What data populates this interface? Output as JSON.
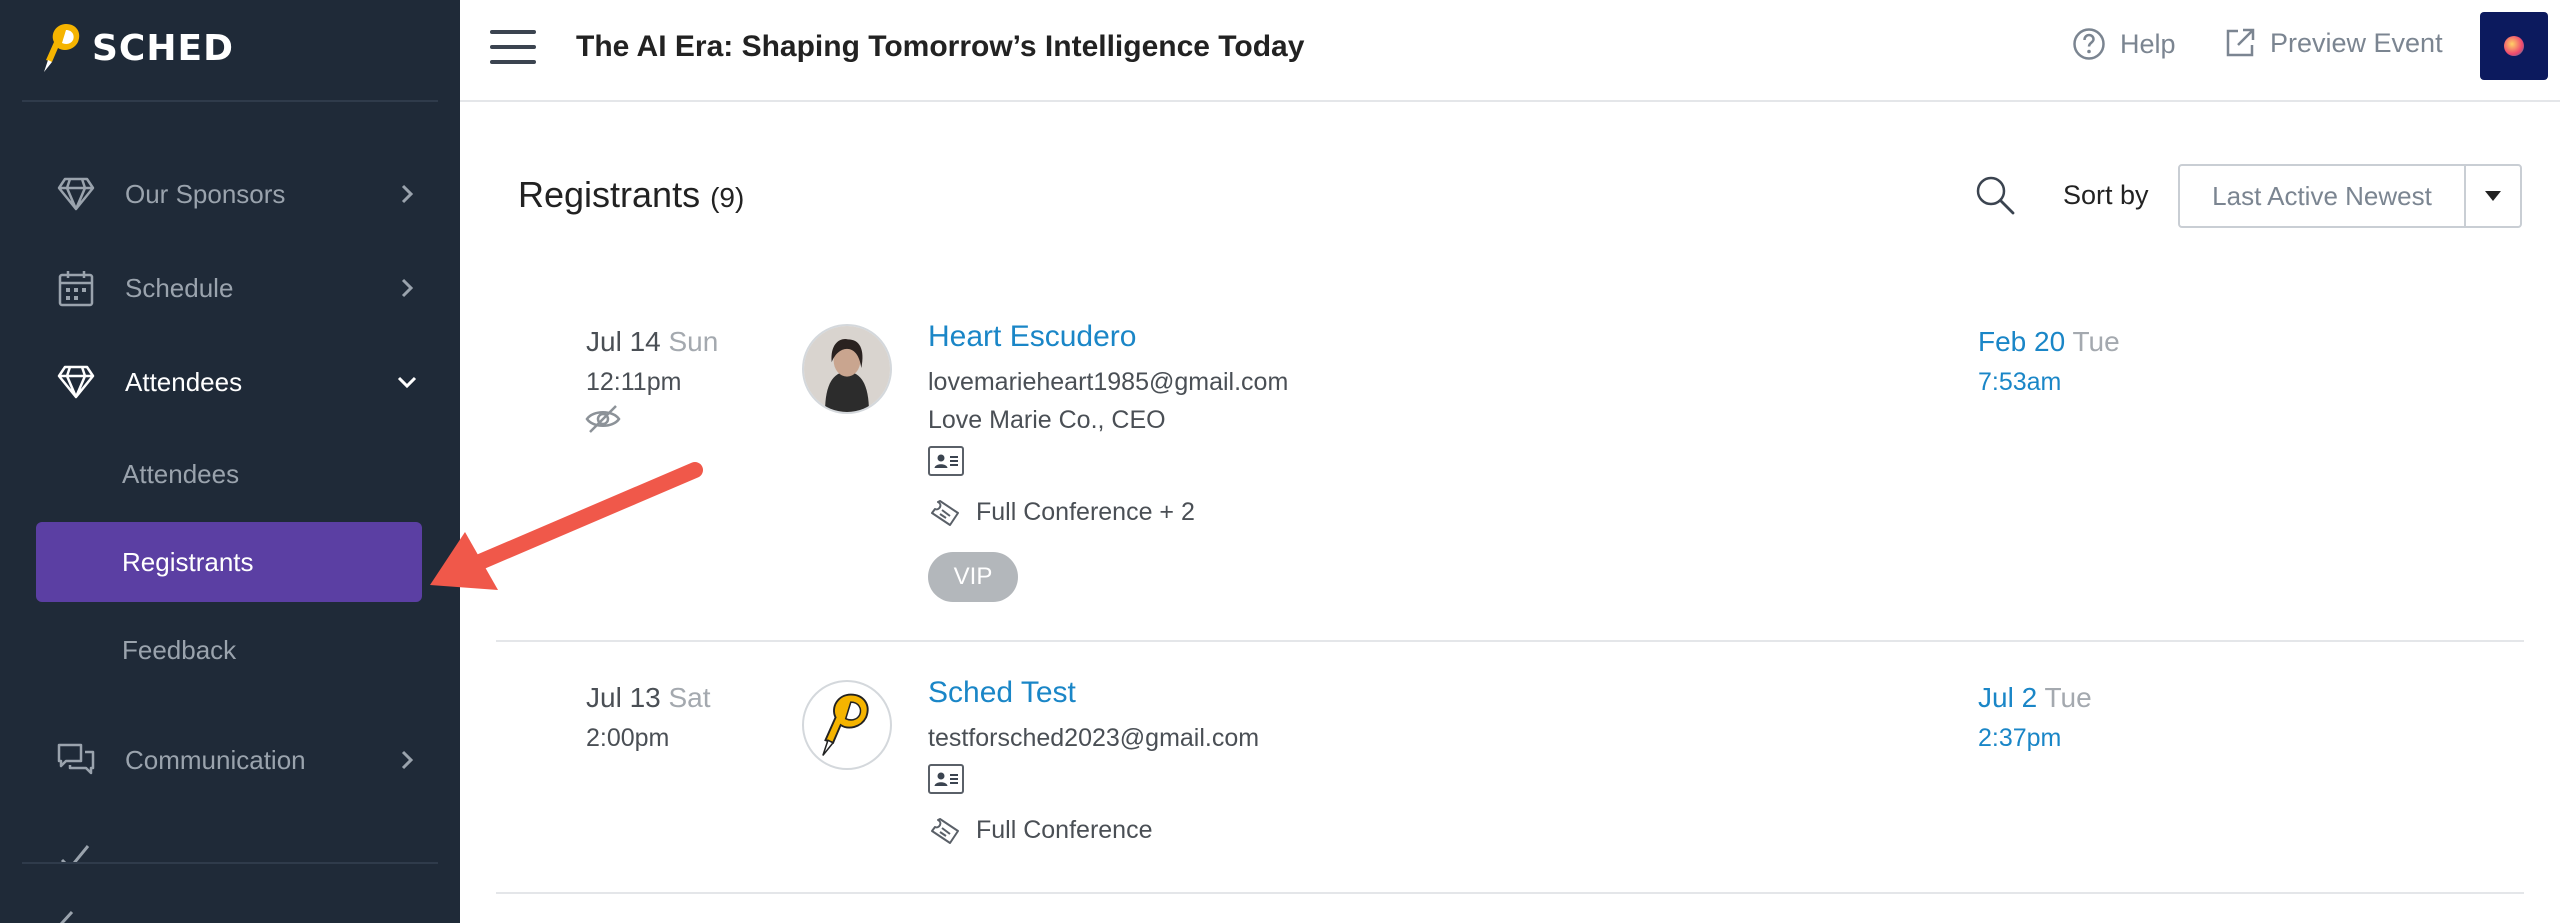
{
  "app": {
    "logo_text": "SCHED"
  },
  "sidebar": {
    "items": [
      {
        "label": "Our Sponsors",
        "icon": "diamond-icon"
      },
      {
        "label": "Schedule",
        "icon": "calendar-icon"
      },
      {
        "label": "Attendees",
        "icon": "diamond-icon",
        "expanded": true
      },
      {
        "label": "Communication",
        "icon": "chat-icon"
      }
    ],
    "subitems": [
      {
        "label": "Attendees"
      },
      {
        "label": "Registrants",
        "selected": true
      },
      {
        "label": "Feedback"
      }
    ]
  },
  "header": {
    "event_title": "The AI Era: Shaping Tomorrow’s Intelligence Today",
    "help_label": "Help",
    "preview_label": "Preview Event"
  },
  "main": {
    "title": "Registrants",
    "count": "(9)",
    "sort_label": "Sort by",
    "sort_value": "Last Active Newest"
  },
  "registrants": [
    {
      "date": "Jul 14",
      "dow": "Sun",
      "time": "12:11pm",
      "name": "Heart Escudero",
      "email": "lovemarieheart1985@gmail.com",
      "company": "Love Marie Co., CEO",
      "ticket": "Full Conference + 2",
      "badge": "VIP",
      "active_date": "Feb 20",
      "active_dow": "Tue",
      "active_time": "7:53am"
    },
    {
      "date": "Jul 13",
      "dow": "Sat",
      "time": "2:00pm",
      "name": "Sched Test",
      "email": "testforsched2023@gmail.com",
      "ticket": "Full Conference",
      "active_date": "Jul 2",
      "active_dow": "Tue",
      "active_time": "2:37pm"
    }
  ],
  "colors": {
    "sidebar_bg": "#1f2a38",
    "selected_bg": "#5b3fa3",
    "link": "#1a86c7",
    "annotation_arrow": "#f0584a"
  }
}
